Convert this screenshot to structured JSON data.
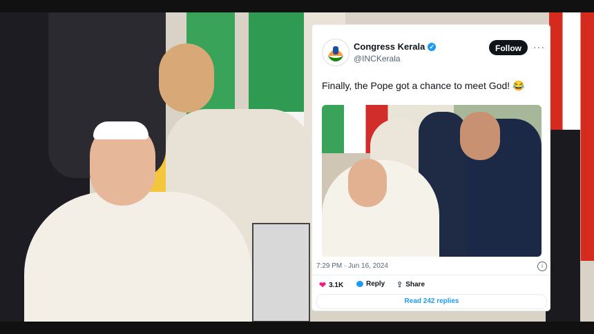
{
  "tweet": {
    "account_name": "Congress Kerala",
    "handle": "@INCKerala",
    "follow_label": "Follow",
    "more_icon": "···",
    "text": "Finally, the Pope got a chance to meet God! 😂",
    "timestamp": "7:29 PM · Jun 16, 2024",
    "info_icon": "i",
    "likes": "3.1K",
    "reply_label": "Reply",
    "share_label": "Share",
    "read_replies": "Read 242 replies"
  },
  "colors": {
    "verified": "#1d9bf0",
    "like": "#f91880",
    "link": "#1d9bf0",
    "follow_bg": "#0f1419"
  }
}
